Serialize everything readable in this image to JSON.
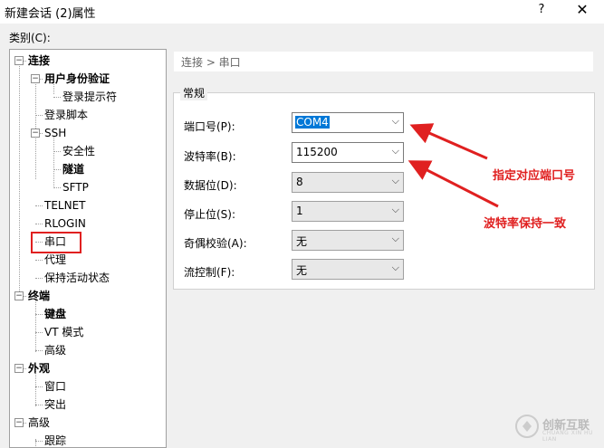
{
  "window": {
    "title": "新建会话 (2)属性",
    "help": "?",
    "close": "✕"
  },
  "category_label": "类别(C):",
  "tree": [
    {
      "label": "连接",
      "bold": true,
      "expander": "−"
    },
    {
      "label": "用户身份验证",
      "bold": true,
      "expander": "−"
    },
    {
      "label": "登录提示符",
      "bold": false
    },
    {
      "label": "登录脚本",
      "bold": false
    },
    {
      "label": "SSH",
      "bold": false,
      "expander": "−"
    },
    {
      "label": "安全性",
      "bold": false
    },
    {
      "label": "隧道",
      "bold": true
    },
    {
      "label": "SFTP",
      "bold": false
    },
    {
      "label": "TELNET",
      "bold": false
    },
    {
      "label": "RLOGIN",
      "bold": false
    },
    {
      "label": "串口",
      "bold": false,
      "selected": true
    },
    {
      "label": "代理",
      "bold": false
    },
    {
      "label": "保持活动状态",
      "bold": false
    },
    {
      "label": "终端",
      "bold": true,
      "expander": "−"
    },
    {
      "label": "键盘",
      "bold": true
    },
    {
      "label": "VT 模式",
      "bold": false
    },
    {
      "label": "高级",
      "bold": false
    },
    {
      "label": "外观",
      "bold": true,
      "expander": "−"
    },
    {
      "label": "窗口",
      "bold": false
    },
    {
      "label": "突出",
      "bold": false
    },
    {
      "label": "高级",
      "bold": false,
      "expander": "−"
    },
    {
      "label": "跟踪",
      "bold": false
    }
  ],
  "breadcrumb": "连接 > 串口",
  "group_title": "常规",
  "fields": [
    {
      "label": "端口号(P):",
      "value": "COM4",
      "active": true
    },
    {
      "label": "波特率(B):",
      "value": "115200",
      "active": true
    },
    {
      "label": "数据位(D):",
      "value": "8",
      "active": false
    },
    {
      "label": "停止位(S):",
      "value": "1",
      "active": false
    },
    {
      "label": "奇偶校验(A):",
      "value": "无",
      "active": false
    },
    {
      "label": "流控制(F):",
      "value": "无",
      "active": false
    }
  ],
  "annotations": {
    "port": "指定对应端口号",
    "baud": "波特率保持一致",
    "color": "#e02020"
  },
  "watermark": {
    "text": "创新互联",
    "sub": "CHUANG XIN HU LIAN"
  },
  "icons": {
    "chevron": "chevron-down-icon",
    "expander": "tree-expander-icon"
  }
}
